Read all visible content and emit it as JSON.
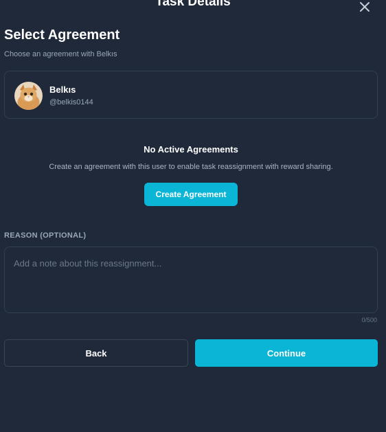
{
  "header": {
    "title": "Task Details",
    "close_icon": "close-icon"
  },
  "agreement": {
    "title": "Select Agreement",
    "subtitle": "Choose an agreement with Belkıs"
  },
  "user": {
    "name": "Belkıs",
    "handle": "@belkis0144",
    "avatar": "cat-avatar"
  },
  "empty_state": {
    "title": "No Active Agreements",
    "description": "Create an agreement with this user to enable task reassignment with reward sharing.",
    "button_label": "Create Agreement"
  },
  "reason": {
    "label": "REASON (OPTIONAL)",
    "placeholder": "Add a note about this reassignment...",
    "value": "",
    "char_count": "0/500"
  },
  "footer": {
    "back_label": "Back",
    "continue_label": "Continue"
  },
  "colors": {
    "background": "#1f293a",
    "accent": "#0bb5d6",
    "border": "#323e52",
    "muted_text": "#9aa6b8"
  }
}
